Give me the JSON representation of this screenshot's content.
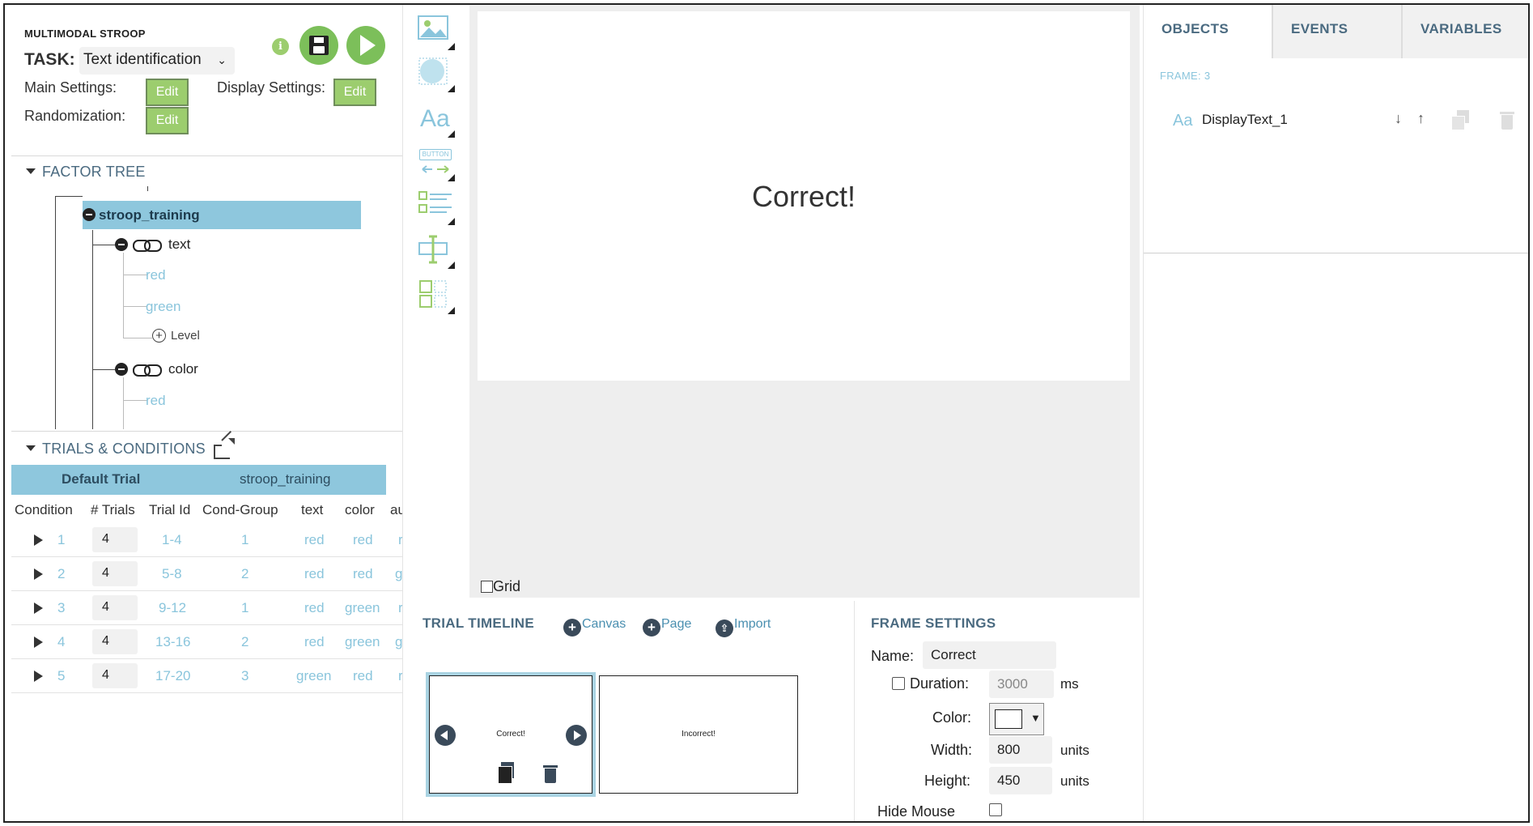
{
  "header": {
    "experiment_name": "MULTIMODAL STROOP",
    "task_label": "TASK:",
    "task_value": "Text identification",
    "main_settings_label": "Main Settings:",
    "display_settings_label": "Display Settings:",
    "randomization_label": "Randomization:",
    "edit_label": "Edit",
    "info_icon": "i"
  },
  "factor_tree": {
    "title": "FACTOR TREE",
    "root": "stroop_training",
    "factors": [
      {
        "name": "text",
        "levels": [
          "red",
          "green"
        ],
        "add_level_label": "Level"
      },
      {
        "name": "color",
        "levels": [
          "red"
        ]
      }
    ]
  },
  "trials": {
    "title": "TRIALS & CONDITIONS",
    "header_left": "Default Trial",
    "header_right": "stroop_training",
    "columns": [
      "Condition",
      "# Trials",
      "Trial Id",
      "Cond-Group",
      "text",
      "color",
      "au"
    ],
    "rows": [
      {
        "condition": "1",
        "trials": "4",
        "trial_id": "1-4",
        "cond_group": "1",
        "text": "red",
        "color": "red",
        "extra": "r"
      },
      {
        "condition": "2",
        "trials": "4",
        "trial_id": "5-8",
        "cond_group": "2",
        "text": "red",
        "color": "red",
        "extra": "gr"
      },
      {
        "condition": "3",
        "trials": "4",
        "trial_id": "9-12",
        "cond_group": "1",
        "text": "red",
        "color": "green",
        "extra": "r"
      },
      {
        "condition": "4",
        "trials": "4",
        "trial_id": "13-16",
        "cond_group": "2",
        "text": "red",
        "color": "green",
        "extra": "gr"
      },
      {
        "condition": "5",
        "trials": "4",
        "trial_id": "17-20",
        "cond_group": "3",
        "text": "green",
        "color": "red",
        "extra": "r"
      }
    ]
  },
  "toolbar": {
    "tools": [
      "image-tool-icon",
      "shape-tool-icon",
      "text-tool-icon",
      "button-tool-icon",
      "list-tool-icon",
      "input-tool-icon",
      "grid-tool-icon"
    ],
    "text_tool_glyph": "Aa",
    "button_tool_glyph": "BUTTON"
  },
  "canvas": {
    "text": "Correct!",
    "grid_label": "Grid"
  },
  "timeline": {
    "title": "TRIAL TIMELINE",
    "actions": {
      "canvas": "Canvas",
      "page": "Page",
      "import": "Import"
    },
    "frames": [
      {
        "label": "Correct!",
        "selected": true
      },
      {
        "label": "Incorrect!",
        "selected": false
      }
    ]
  },
  "frame_settings": {
    "title": "FRAME SETTINGS",
    "name_label": "Name:",
    "name_value": "Correct",
    "duration_label": "Duration:",
    "duration_value": "3000",
    "duration_unit": "ms",
    "color_label": "Color:",
    "color_value": "#ffffff",
    "dropdown_glyph": "▼",
    "width_label": "Width:",
    "width_value": "800",
    "width_unit": "units",
    "height_label": "Height:",
    "height_value": "450",
    "height_unit": "units",
    "hide_mouse_label": "Hide Mouse"
  },
  "right_panel": {
    "tabs": [
      "OBJECTS",
      "EVENTS",
      "VARIABLES"
    ],
    "frame_label": "FRAME: 3",
    "objects": [
      {
        "icon": "Aa",
        "name": "DisplayText_1"
      }
    ],
    "arrow_down": "↓",
    "arrow_up": "↑"
  },
  "colors": {
    "accent_green": "#9ccd6e",
    "play_green": "#7cbf5a",
    "selection_blue": "#8ec7dd",
    "link_blue": "#4a8fb0",
    "heading_slate": "#4a6a80"
  }
}
